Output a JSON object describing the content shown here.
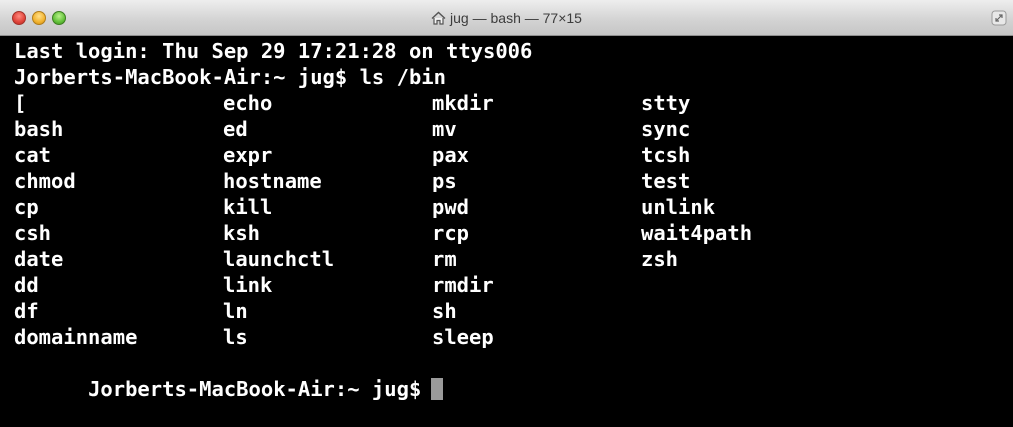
{
  "window": {
    "title": "jug — bash — 77×15"
  },
  "terminal": {
    "last_login": "Last login: Thu Sep 29 17:21:28 on ttys006",
    "prompt_command": "Jorberts-MacBook-Air:~ jug$ ls /bin",
    "columns": [
      [
        "[",
        "bash",
        "cat",
        "chmod",
        "cp",
        "csh",
        "date",
        "dd",
        "df",
        "domainname"
      ],
      [
        "echo",
        "ed",
        "expr",
        "hostname",
        "kill",
        "ksh",
        "launchctl",
        "link",
        "ln",
        "ls"
      ],
      [
        "mkdir",
        "mv",
        "pax",
        "ps",
        "pwd",
        "rcp",
        "rm",
        "rmdir",
        "sh",
        "sleep"
      ],
      [
        "stty",
        "sync",
        "tcsh",
        "test",
        "unlink",
        "wait4path",
        "zsh"
      ]
    ],
    "final_prompt": "Jorberts-MacBook-Air:~ jug$"
  },
  "colors": {
    "background": "#000000",
    "text": "#ffffff",
    "cursor": "#9a9a9a"
  }
}
